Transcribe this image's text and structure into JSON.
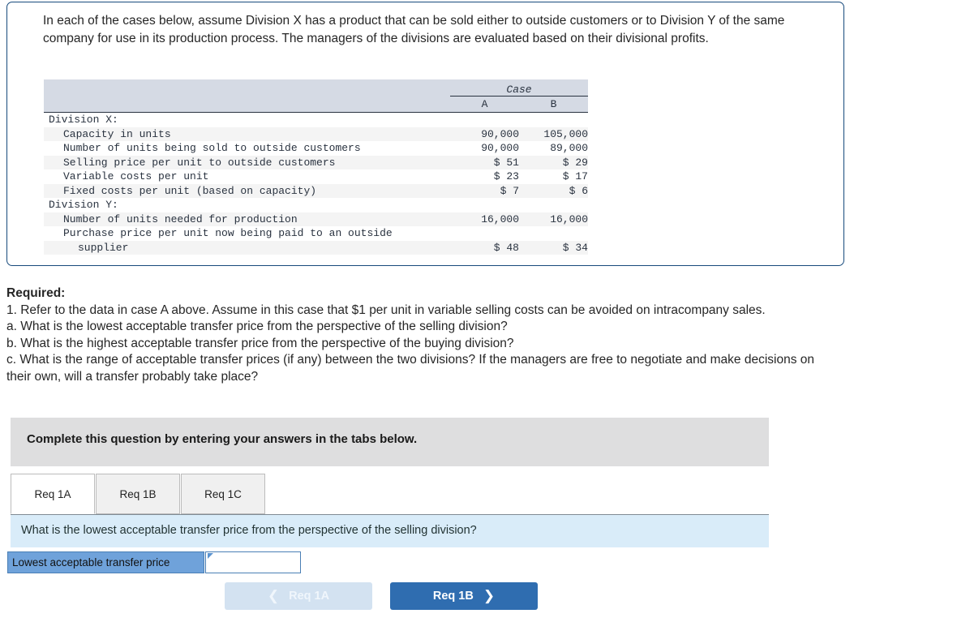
{
  "problem": {
    "intro": "In each of the cases below, assume Division X has a product that can be sold either to outside customers or to Division Y of the same company for use in its production process. The managers of the divisions are evaluated based on their divisional profits."
  },
  "table": {
    "group_header": "Case",
    "columns": [
      "A",
      "B"
    ],
    "rows": [
      {
        "label": "Division X:",
        "indent": 0,
        "a": "",
        "b": ""
      },
      {
        "label": "Capacity in units",
        "indent": 1,
        "a": "90,000",
        "b": "105,000"
      },
      {
        "label": "Number of units being sold to outside customers",
        "indent": 1,
        "a": "90,000",
        "b": "89,000"
      },
      {
        "label": "Selling price per unit to outside customers",
        "indent": 1,
        "a": "$ 51",
        "b": "$ 29"
      },
      {
        "label": "Variable costs per unit",
        "indent": 1,
        "a": "$ 23",
        "b": "$ 17"
      },
      {
        "label": "Fixed costs per unit (based on capacity)",
        "indent": 1,
        "a": "$ 7",
        "b": "$ 6"
      },
      {
        "label": "Division Y:",
        "indent": 0,
        "a": "",
        "b": ""
      },
      {
        "label": "Number of units needed for production",
        "indent": 1,
        "a": "16,000",
        "b": "16,000"
      },
      {
        "label": "Purchase price per unit now being paid to an outside",
        "indent": 1,
        "a": "",
        "b": ""
      },
      {
        "label": "supplier",
        "indent": 2,
        "a": "$ 48",
        "b": "$ 34"
      }
    ]
  },
  "required": {
    "title": "Required:",
    "item1": "1. Refer to the data in case A above. Assume in this case that $1 per unit in variable selling costs can be avoided on intracompany sales.",
    "item_a": "a. What is the lowest acceptable transfer price from the perspective of the selling division?",
    "item_b": "b. What is the highest acceptable transfer price from the perspective of the buying division?",
    "item_c": "c. What is the range of acceptable transfer prices (if any) between the two divisions? If the managers are free to negotiate and make decisions on their own, will a transfer probably take place?"
  },
  "instruction_banner": {
    "text": "Complete this question by entering your answers in the tabs below."
  },
  "tabs": [
    {
      "label": "Req 1A",
      "active": true
    },
    {
      "label": "Req 1B",
      "active": false
    },
    {
      "label": "Req 1C",
      "active": false
    }
  ],
  "question_bar": {
    "text": "What is the lowest acceptable transfer price from the perspective of the selling division?"
  },
  "answer": {
    "label": "Lowest acceptable transfer price",
    "value": "",
    "placeholder": ""
  },
  "nav": {
    "prev_label": "Req 1A",
    "prev_icon": "chevron-left-icon",
    "next_label": "Req 1B",
    "next_icon": "chevron-right-icon"
  },
  "colors": {
    "box_border": "#174a7c",
    "table_header_bg": "#d5dae4",
    "banner_bg": "#dededf",
    "question_bar_bg": "#d9ecf9",
    "answer_label_bg": "#6fa2da",
    "next_button_bg": "#2f6db0",
    "prev_button_bg": "#d3e2f1"
  }
}
